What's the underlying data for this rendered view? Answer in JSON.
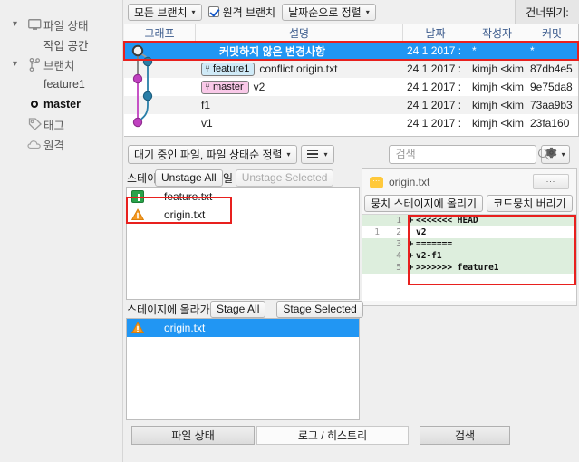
{
  "sidebar": {
    "items": [
      {
        "label": "파일 상태",
        "icon": "monitor-icon",
        "chevron": "▾",
        "kind": "root"
      },
      {
        "label": "작업 공간",
        "icon": "",
        "chevron": "",
        "kind": "child"
      },
      {
        "label": "브랜치",
        "icon": "branch-icon",
        "chevron": "▾",
        "kind": "root"
      },
      {
        "label": "feature1",
        "icon": "",
        "chevron": "",
        "kind": "child"
      },
      {
        "label": "master",
        "icon": "current-dot-icon",
        "chevron": "",
        "kind": "current"
      },
      {
        "label": "태그",
        "icon": "tag-icon",
        "chevron": "",
        "kind": "root"
      },
      {
        "label": "원격",
        "icon": "cloud-icon",
        "chevron": "",
        "kind": "root"
      }
    ]
  },
  "toolbar": {
    "branch_filter": "모든 브랜치",
    "remote_branch_label": "원격 브랜치",
    "remote_branch_checked": true,
    "sort_order": "날짜순으로 정렬",
    "skip_label": "건너뛰기:"
  },
  "commit_table": {
    "columns": [
      "그래프",
      "설명",
      "날짜",
      "작성자",
      "커밋"
    ],
    "rows": [
      {
        "desc": "커밋하지 않은 변경사항",
        "date": "24 1 2017 :",
        "author": "*",
        "hash": "*",
        "selected": true,
        "chip": null
      },
      {
        "desc": "conflict origin.txt",
        "date": "24 1 2017 :",
        "author": "kimjh <kim",
        "hash": "87db4e5",
        "selected": false,
        "chip": {
          "label": "feature1",
          "style": "feature"
        }
      },
      {
        "desc": "v2",
        "date": "24 1 2017 :",
        "author": "kimjh <kim",
        "hash": "9e75da8",
        "selected": false,
        "chip": {
          "label": "master",
          "style": "master"
        }
      },
      {
        "desc": "f1",
        "date": "24 1 2017 :",
        "author": "kimjh <kim",
        "hash": "73aa9b3",
        "selected": false,
        "chip": null
      },
      {
        "desc": "v1",
        "date": "24 1 2017 :",
        "author": "kimjh <kim",
        "hash": "23fa160",
        "selected": false,
        "chip": null
      }
    ]
  },
  "mid_toolbar": {
    "file_sort": "대기 중인 파일, 파일 상태순 정렬",
    "view_mode_icon": "list-view-icon",
    "search_placeholder": "검색",
    "search_value": "",
    "gear_icon": "gear-icon"
  },
  "unstaged": {
    "header_label": "스테이지에 올라간 파일",
    "unstage_all": "Unstage All",
    "unstage_selected": "Unstage Selected",
    "files": [
      {
        "name": "feature.txt",
        "status": "added",
        "selected": false
      },
      {
        "name": "origin.txt",
        "status": "conflict",
        "selected": false
      }
    ]
  },
  "staged": {
    "header_label": "스테이지에 올라가지 않은 파일",
    "stage_all": "Stage All",
    "stage_selected": "Stage Selected",
    "files": [
      {
        "name": "origin.txt",
        "status": "conflict",
        "selected": true
      }
    ]
  },
  "diff": {
    "filename": "origin.txt",
    "file_icon": "text-file-icon",
    "more_button": "...",
    "stage_hunk": "뭉치 스테이지에 올리기",
    "discard_hunk": "코드뭉치 버리기",
    "lines": [
      {
        "old": "",
        "new": "1",
        "sign": "+",
        "text": "<<<<<<< HEAD",
        "type": "add"
      },
      {
        "old": "1",
        "new": "2",
        "sign": " ",
        "text": "v2",
        "type": "ctx"
      },
      {
        "old": "",
        "new": "3",
        "sign": "+",
        "text": "=======",
        "type": "add"
      },
      {
        "old": "",
        "new": "4",
        "sign": "+",
        "text": "v2-f1",
        "type": "add"
      },
      {
        "old": "",
        "new": "5",
        "sign": "+",
        "text": ">>>>>>> feature1",
        "type": "add"
      }
    ]
  },
  "bottom_tabs": [
    {
      "label": "파일 상태",
      "active": false
    },
    {
      "label": "로그 / 히스토리",
      "active": true
    },
    {
      "label": "검색",
      "active": false
    }
  ],
  "colors": {
    "selection_blue": "#2196f3",
    "annotation_red": "#e8201e",
    "graph_purple": "#c040c0",
    "graph_teal": "#2a7fa8",
    "diff_add_green": "#ddeedd"
  }
}
